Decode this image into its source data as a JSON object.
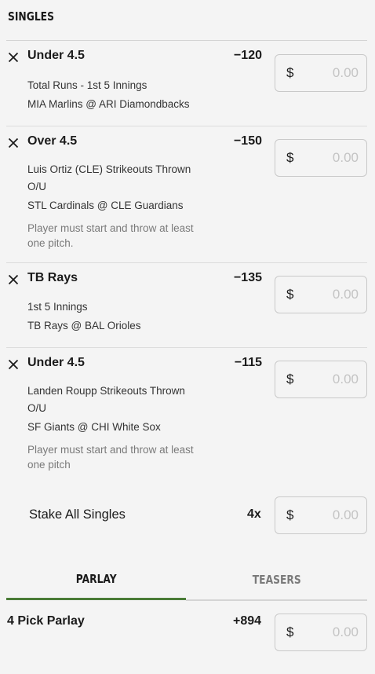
{
  "section_title": "SINGLES",
  "bets": [
    {
      "selection": "Under 4.5",
      "odds": "−120",
      "lines": [
        "Total Runs - 1st 5 Innings",
        "MIA Marlins @ ARI Diamondbacks"
      ],
      "note": "",
      "stake_currency": "$",
      "stake_placeholder": "0.00"
    },
    {
      "selection": "Over 4.5",
      "odds": "−150",
      "lines": [
        "Luis Ortiz (CLE) Strikeouts Thrown O/U",
        "STL Cardinals @ CLE Guardians"
      ],
      "note": "Player must start and throw at least one pitch.",
      "stake_currency": "$",
      "stake_placeholder": "0.00"
    },
    {
      "selection": "TB Rays",
      "odds": "−135",
      "lines": [
        "1st 5 Innings",
        "TB Rays @ BAL Orioles"
      ],
      "note": "",
      "stake_currency": "$",
      "stake_placeholder": "0.00"
    },
    {
      "selection": "Under 4.5",
      "odds": "−115",
      "lines": [
        "Landen Roupp Strikeouts Thrown O/U",
        "SF Giants @ CHI White Sox"
      ],
      "note": "Player must start and throw at least one pitch",
      "stake_currency": "$",
      "stake_placeholder": "0.00"
    }
  ],
  "stake_all": {
    "label": "Stake All Singles",
    "count": "4x",
    "currency": "$",
    "placeholder": "0.00"
  },
  "tabs": {
    "parlay": "PARLAY",
    "teasers": "TEASERS",
    "active": "parlay"
  },
  "parlay": {
    "title": "4 Pick Parlay",
    "odds": "+894",
    "currency": "$",
    "placeholder": "0.00"
  },
  "colors": {
    "accent": "#4a7c37",
    "background": "#f4f4f4"
  },
  "icons": {
    "remove": "close-icon"
  }
}
